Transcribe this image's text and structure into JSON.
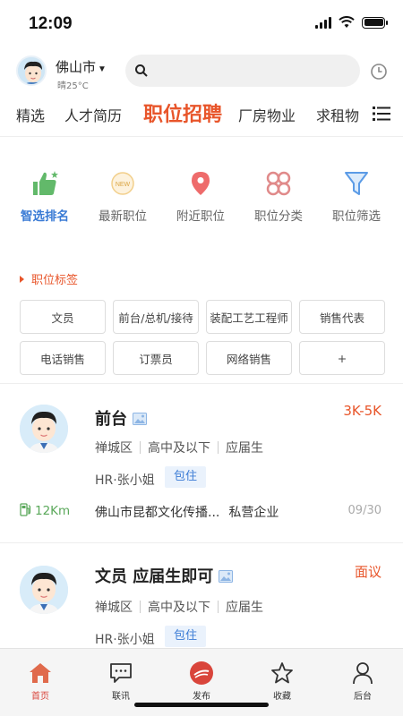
{
  "status": {
    "time": "12:09"
  },
  "header": {
    "city": "佛山市",
    "weather": "晴25°C",
    "search_placeholder": ""
  },
  "tabs": [
    {
      "label": "精选"
    },
    {
      "label": "人才简历"
    },
    {
      "label": "职位招聘",
      "active": true
    },
    {
      "label": "厂房物业"
    },
    {
      "label": "求租物"
    }
  ],
  "features": [
    {
      "label": "智选排名",
      "icon": "thumbs-up-icon",
      "active": true
    },
    {
      "label": "最新职位",
      "icon": "new-badge-icon"
    },
    {
      "label": "附近职位",
      "icon": "location-pin-icon"
    },
    {
      "label": "职位分类",
      "icon": "category-icon"
    },
    {
      "label": "职位筛选",
      "icon": "filter-icon"
    }
  ],
  "tags": {
    "title": "职位标签",
    "items": [
      "文员",
      "前台/总机/接待",
      "装配工艺工程师",
      "销售代表",
      "电话销售",
      "订票员",
      "网络销售",
      "+"
    ]
  },
  "jobs": [
    {
      "title": "前台",
      "salary": "3K-5K",
      "district": "禅城区",
      "education": "高中及以下",
      "experience": "应届生",
      "hr": "HR·张小姐",
      "benefit": "包住",
      "distance": "12Km",
      "company": "佛山市昆都文化传播...",
      "company_type": "私营企业",
      "date": "09/30"
    },
    {
      "title": "文员 应届生即可",
      "salary": "面议",
      "district": "禅城区",
      "education": "高中及以下",
      "experience": "应届生",
      "hr": "HR·张小姐",
      "benefit": "包住"
    }
  ],
  "bottom_nav": [
    {
      "label": "首页",
      "icon": "home-icon",
      "active": true
    },
    {
      "label": "联讯",
      "icon": "chat-icon"
    },
    {
      "label": "发布",
      "icon": "publish-icon"
    },
    {
      "label": "收藏",
      "icon": "star-icon"
    },
    {
      "label": "后台",
      "icon": "profile-icon"
    }
  ],
  "colors": {
    "accent": "#e8552a",
    "blue": "#3a7bd5",
    "green": "#5aa85a"
  }
}
